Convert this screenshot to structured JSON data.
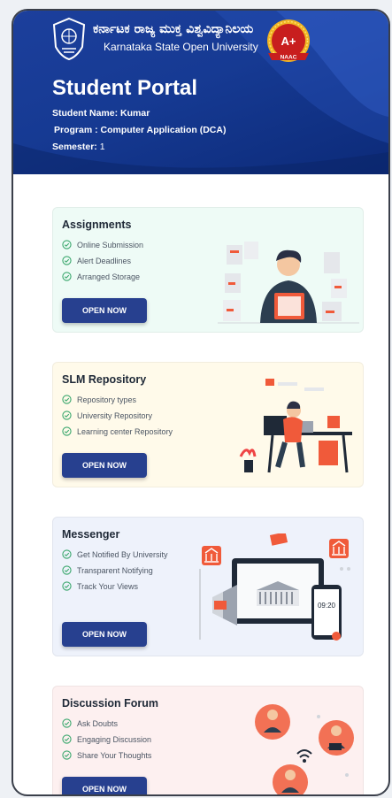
{
  "header": {
    "university_kannada": "ಕರ್ನಾಟಕ ರಾಜ್ಯ ಮುಕ್ತ ವಿಶ್ವವಿದ್ಯಾನಿಲಯ",
    "university_english": "Karnataka State Open University",
    "naac_grade": "A+",
    "naac_label": "NAAC",
    "portal_title": "Student Portal",
    "student_name_label": "Student Name:",
    "student_name_value": "Kumar",
    "program_label": "Program :",
    "program_value": "Computer Application (DCA)",
    "semester_label": "Semester:",
    "semester_value": "1"
  },
  "cards": [
    {
      "title": "Assignments",
      "features": [
        "Online Submission",
        "Alert Deadlines",
        "Arranged Storage"
      ],
      "button": "OPEN NOW",
      "bg": "#eefbf6"
    },
    {
      "title_bold": "SLM",
      "title_rest": " Repository",
      "features": [
        "Repository types",
        "University Repository",
        "Learning center Repository"
      ],
      "button": "OPEN NOW",
      "bg": "#fffaea"
    },
    {
      "title": "Messenger",
      "features": [
        "Get Notified By University",
        "Transparent Notifying",
        "Track Your Views"
      ],
      "button": "OPEN NOW",
      "bg": "#eef2fb",
      "clock": "09:20"
    },
    {
      "title": "Discussion Forum",
      "features": [
        "Ask Doubts",
        "Engaging Discussion",
        "Share Your Thoughts"
      ],
      "button": "OPEN NOW",
      "bg": "#fdf0f0"
    }
  ],
  "colors": {
    "header_blue": "#1c3f9c",
    "button_blue": "#27408f",
    "check_green": "#3aa76d",
    "accent_orange": "#f05a3a"
  }
}
